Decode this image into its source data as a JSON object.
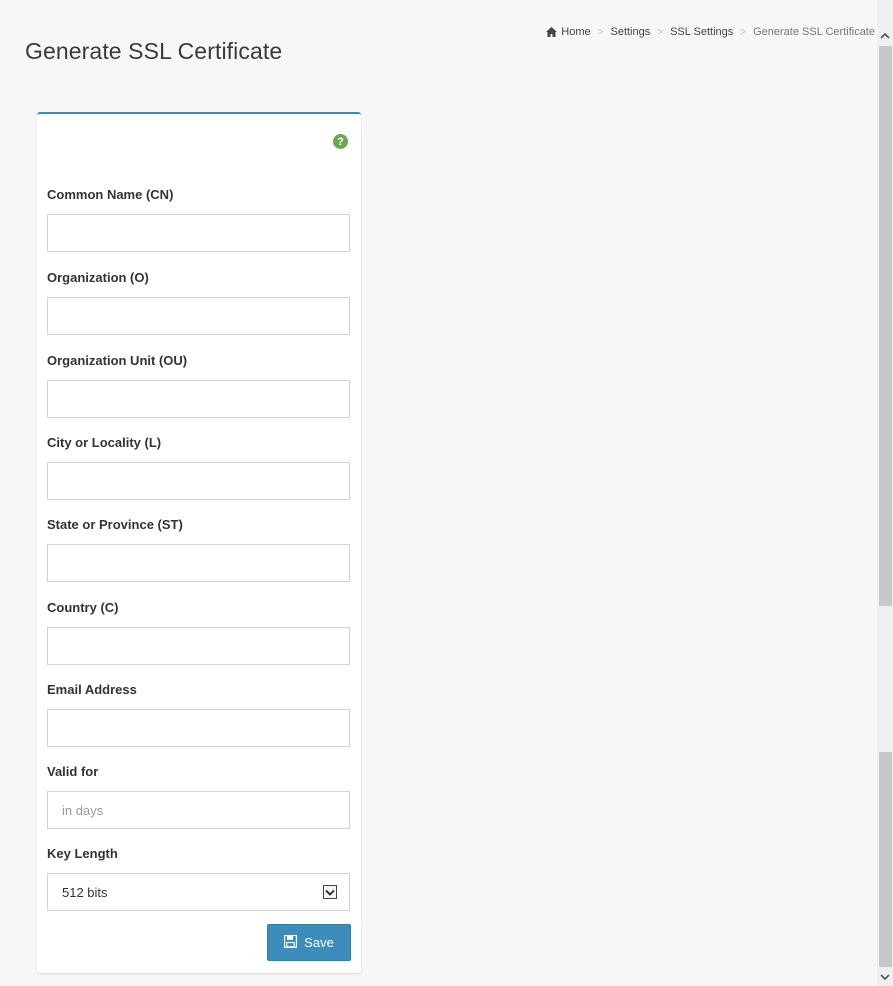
{
  "header": {
    "title": "Generate SSL Certificate"
  },
  "breadcrumb": {
    "items": [
      "Home",
      "Settings",
      "SSL Settings",
      "Generate SSL Certificate"
    ],
    "separator": ">"
  },
  "form": {
    "help_icon": "question-circle-icon",
    "fields": [
      {
        "label": "Common Name (CN)",
        "value": "",
        "placeholder": ""
      },
      {
        "label": "Organization (O)",
        "value": "",
        "placeholder": ""
      },
      {
        "label": "Organization Unit (OU)",
        "value": "",
        "placeholder": ""
      },
      {
        "label": "City or Locality (L)",
        "value": "",
        "placeholder": ""
      },
      {
        "label": "State or Province (ST)",
        "value": "",
        "placeholder": ""
      },
      {
        "label": "Country (C)",
        "value": "",
        "placeholder": ""
      },
      {
        "label": "Email Address",
        "value": "",
        "placeholder": ""
      },
      {
        "label": "Valid for",
        "value": "",
        "placeholder": "in days"
      }
    ],
    "key_length": {
      "label": "Key Length",
      "selected": "512 bits"
    },
    "save_label": "Save"
  },
  "colors": {
    "accent": "#3c8dbc",
    "help_icon": "#6aa84f"
  }
}
